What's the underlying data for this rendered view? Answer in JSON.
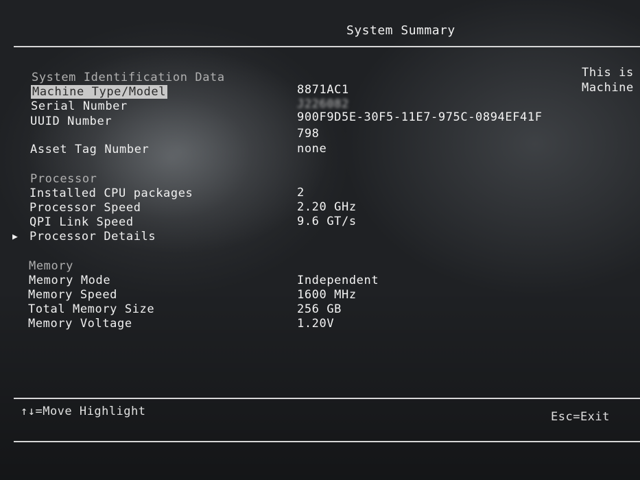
{
  "header": {
    "title": "System Summary"
  },
  "help_panel": {
    "line1": "This is",
    "line2": "Machine"
  },
  "identification": {
    "section_title": "System Identification Data",
    "machine_type_label": "Machine Type/Model",
    "machine_type_value": "8871AC1",
    "serial_label": "Serial Number",
    "serial_value": "J226082",
    "uuid_label": "UUID Number",
    "uuid_value_line1": "900F9D5E-30F5-11E7-975C-0894EF41F",
    "uuid_value_line2": "798",
    "asset_label": "Asset Tag Number",
    "asset_value": "none"
  },
  "processor": {
    "section_title": "Processor",
    "packages_label": "Installed CPU packages",
    "packages_value": "2",
    "speed_label": "Processor Speed",
    "speed_value": "2.20 GHz",
    "qpi_label": "QPI Link Speed",
    "qpi_value": "9.6 GT/s",
    "details_label": "Processor Details",
    "details_pointer": "▶"
  },
  "memory": {
    "section_title": "Memory",
    "mode_label": "Memory Mode",
    "mode_value": "Independent",
    "speed_label": "Memory Speed",
    "speed_value": "1600 MHz",
    "size_label": "Total Memory Size",
    "size_value": "256 GB",
    "voltage_label": "Memory Voltage",
    "voltage_value": "1.20V"
  },
  "footer": {
    "move_hint": "↑↓=Move Highlight",
    "exit_hint": "Esc=Exit"
  }
}
